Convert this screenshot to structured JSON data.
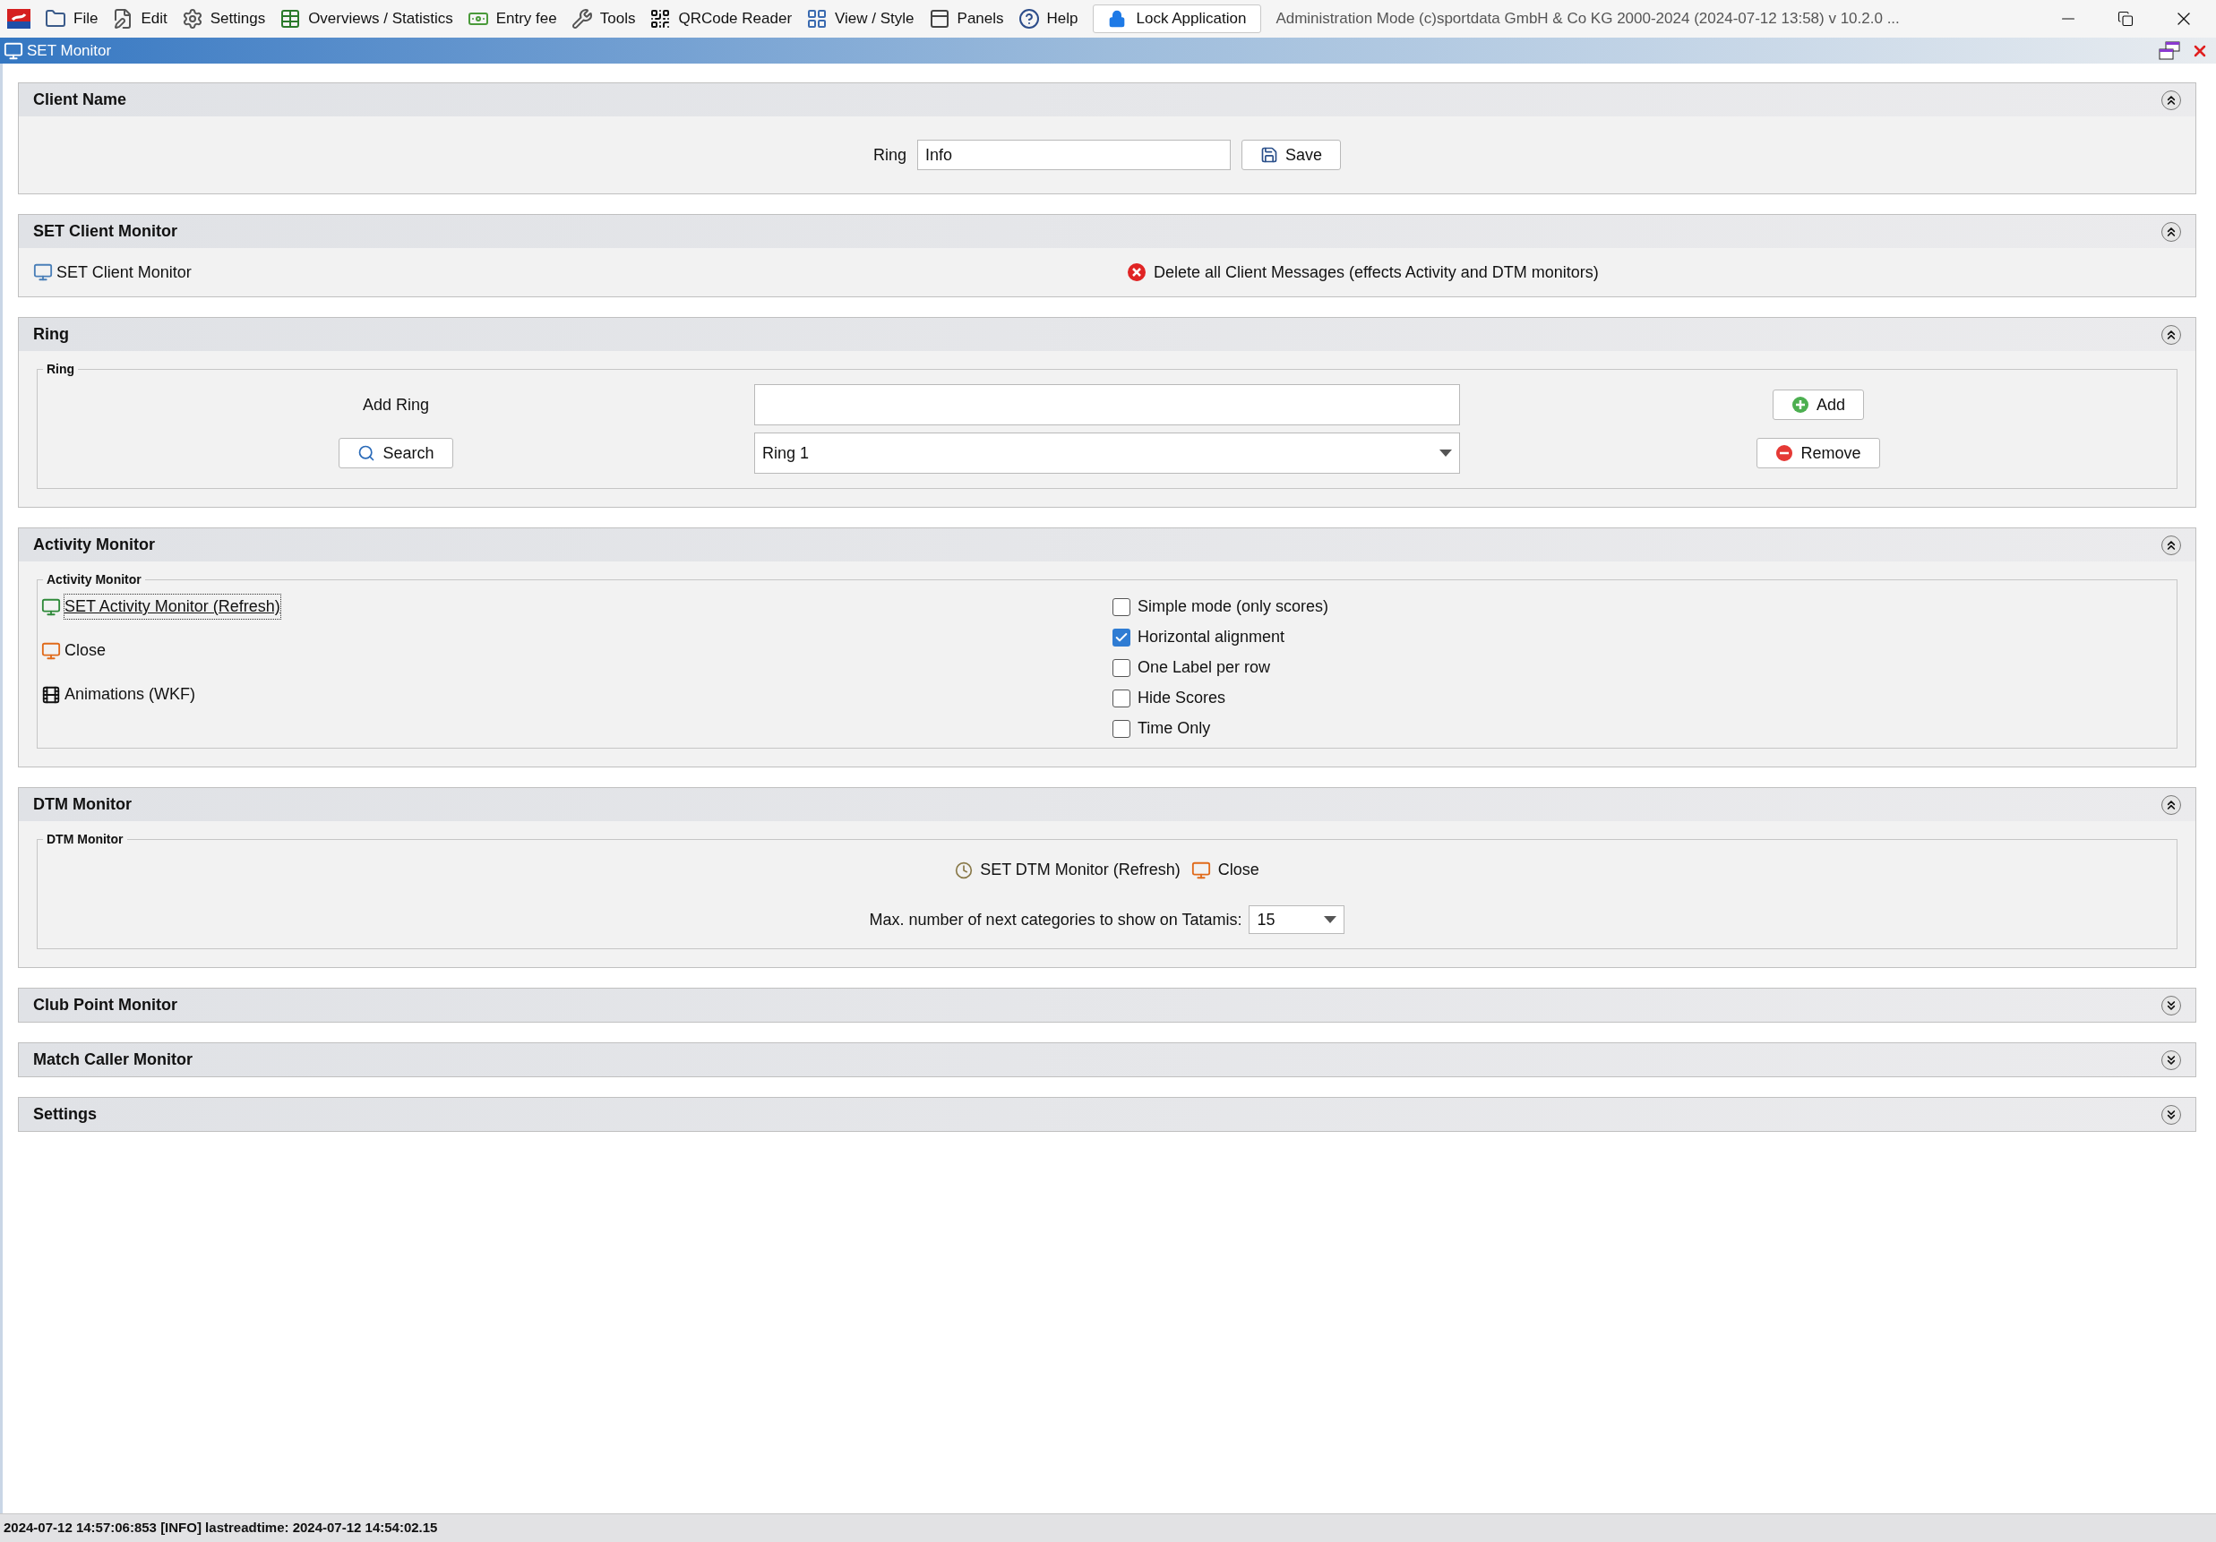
{
  "menu_bar": {
    "items": [
      {
        "label": "File"
      },
      {
        "label": "Edit"
      },
      {
        "label": "Settings"
      },
      {
        "label": "Overviews / Statistics"
      },
      {
        "label": "Entry fee"
      },
      {
        "label": "Tools"
      },
      {
        "label": "QRCode Reader"
      },
      {
        "label": "View / Style"
      },
      {
        "label": "Panels"
      },
      {
        "label": "Help"
      }
    ],
    "lock_button": "Lock Application",
    "app_title": "Administration Mode (c)sportdata GmbH & Co KG 2000-2024 (2024-07-12 13:58)  v 10.2.0 ..."
  },
  "window": {
    "title": "SET Monitor"
  },
  "sections": [
    {
      "kind": "client_name",
      "title": "Client Name",
      "expanded": true,
      "ring_label": "Ring",
      "ring_value": "Info",
      "save_button": "Save"
    },
    {
      "kind": "client_monitor",
      "title": "SET Client Monitor",
      "expanded": true,
      "monitor_link": "SET Client Monitor",
      "delete_link": "Delete all Client Messages (effects Activity and DTM monitors)"
    },
    {
      "kind": "ring",
      "title": "Ring",
      "expanded": true,
      "group_label": "Ring",
      "add_label": "Add Ring",
      "search_button": "Search",
      "ring_select": "Ring 1",
      "add_button": "Add",
      "remove_button": "Remove"
    },
    {
      "kind": "activity",
      "title": "Activity Monitor",
      "expanded": true,
      "group_label": "Activity Monitor",
      "actions": [
        {
          "label": "SET Activity Monitor (Refresh)",
          "focused": true
        },
        {
          "label": "Close",
          "focused": false
        },
        {
          "label": "Animations (WKF)",
          "focused": false
        }
      ],
      "options": [
        {
          "label": "Simple mode (only scores)",
          "checked": false
        },
        {
          "label": "Horizontal alignment",
          "checked": true
        },
        {
          "label": "One Label per row",
          "checked": false
        },
        {
          "label": "Hide Scores",
          "checked": false
        },
        {
          "label": "Time Only",
          "checked": false
        }
      ]
    },
    {
      "kind": "dtm",
      "title": "DTM Monitor",
      "expanded": true,
      "group_label": "DTM Monitor",
      "refresh_link": "SET DTM Monitor (Refresh)",
      "close_link": "Close",
      "max_label": "Max. number of next categories to show on Tatamis:",
      "max_value": "15"
    },
    {
      "title": "Club Point Monitor",
      "expanded": false
    },
    {
      "title": "Match Caller Monitor",
      "expanded": false
    },
    {
      "title": "Settings",
      "expanded": false
    }
  ],
  "status_bar": "2024-07-12 14:57:06:853 [INFO] lastreadtime: 2024-07-12 14:54:02.15"
}
